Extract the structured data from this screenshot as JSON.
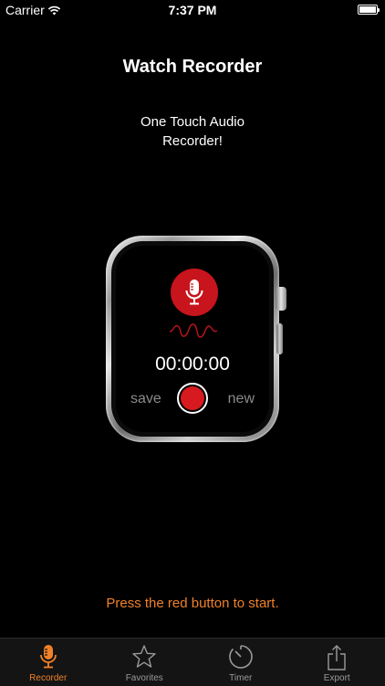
{
  "status_bar": {
    "carrier": "Carrier",
    "time": "7:37 PM"
  },
  "header": {
    "title": "Watch Recorder"
  },
  "tagline": {
    "line1": "One Touch Audio",
    "line2": "Recorder!"
  },
  "watch": {
    "timer": "00:00:00",
    "save_label": "save",
    "new_label": "new",
    "accent_color": "#c8141c"
  },
  "hint": "Press the red button to start.",
  "tab_bar": {
    "active_color": "#f0812a",
    "tabs": [
      {
        "label": "Recorder",
        "icon": "microphone-icon",
        "active": true
      },
      {
        "label": "Favorites",
        "icon": "star-icon",
        "active": false
      },
      {
        "label": "Timer",
        "icon": "timer-icon",
        "active": false
      },
      {
        "label": "Export",
        "icon": "share-icon",
        "active": false
      }
    ]
  }
}
